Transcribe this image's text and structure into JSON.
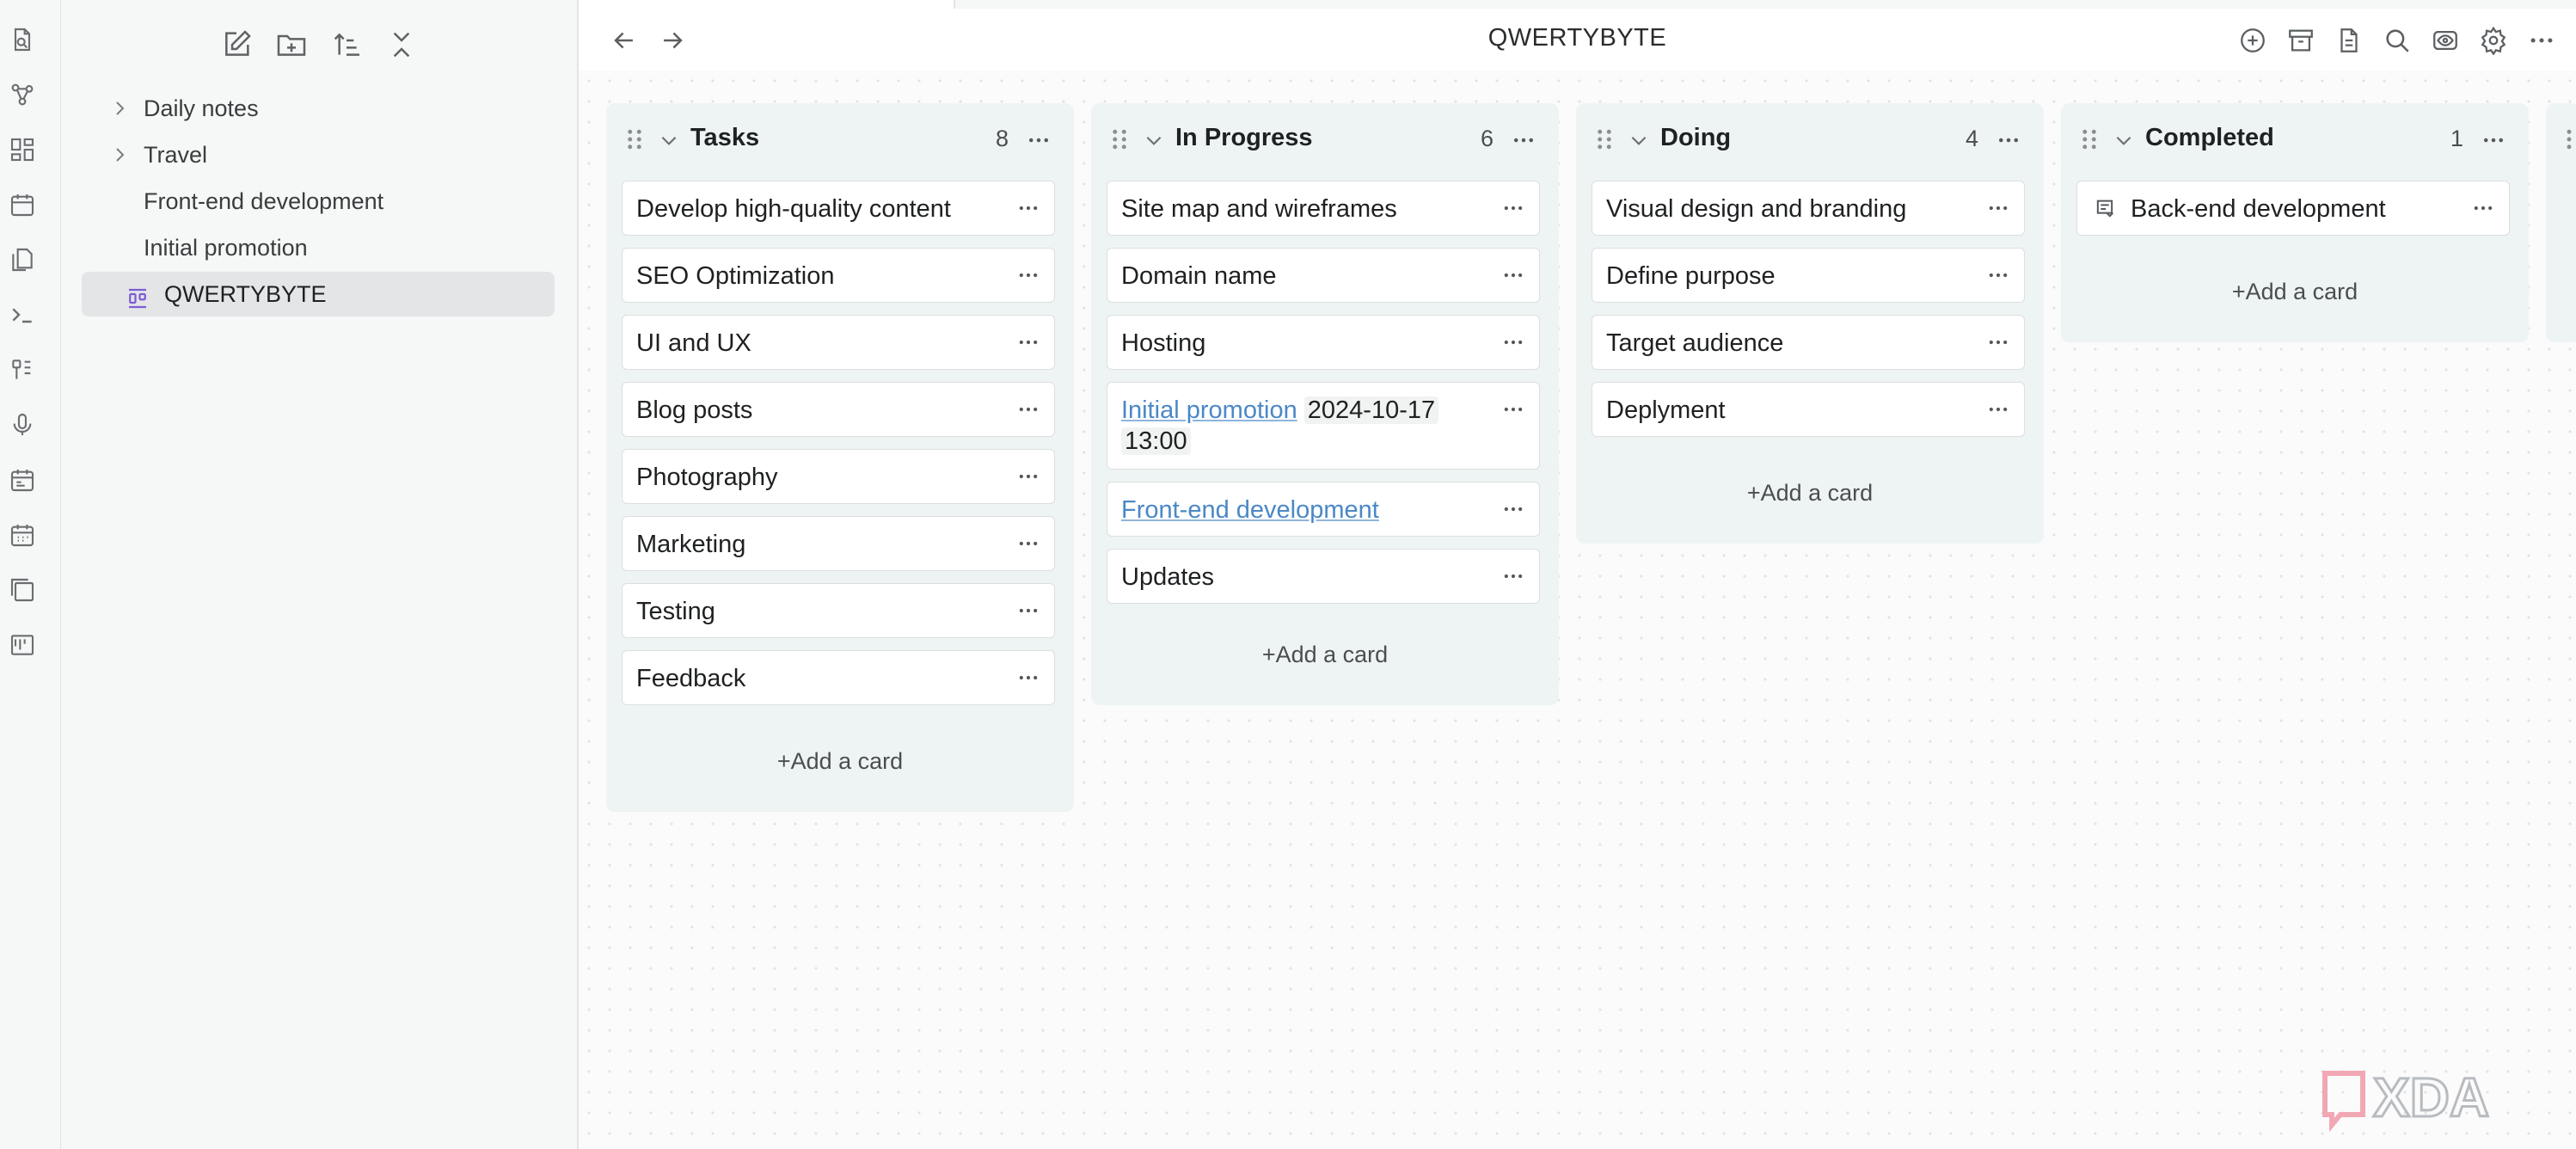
{
  "window": {
    "doc_title": "QWERTYBYTE"
  },
  "sidebar": {
    "tools": [
      "new-note-icon",
      "new-folder-icon",
      "sort-icon",
      "collapse-all-icon"
    ],
    "items": [
      {
        "label": "Daily notes",
        "type": "folder"
      },
      {
        "label": "Travel",
        "type": "folder"
      },
      {
        "label": "Front-end development",
        "type": "note"
      },
      {
        "label": "Initial promotion",
        "type": "note"
      },
      {
        "label": "QWERTYBYTE",
        "type": "kanban",
        "active": true
      }
    ]
  },
  "ribbon": {
    "icons": [
      "open-file-icon",
      "graph-view-icon",
      "canvas-icon",
      "daily-note-icon",
      "templates-icon",
      "command-palette-icon",
      "workspaces-icon",
      "audio-recorder-icon",
      "calendar-icon",
      "calendar-grid-icon",
      "slides-icon",
      "kanban-icon"
    ]
  },
  "toolbar": {
    "icons": [
      "add-icon",
      "archive-icon",
      "markdown-icon",
      "search-icon",
      "reading-view-icon",
      "settings-icon",
      "more-options-icon"
    ]
  },
  "board": {
    "add_label": "+Add a card",
    "lanes": [
      {
        "title": "Tasks",
        "count": "8",
        "cards": [
          {
            "text": "Develop high-quality content"
          },
          {
            "text": "SEO Optimization"
          },
          {
            "text": "UI and UX"
          },
          {
            "text": "Blog posts"
          },
          {
            "text": "Photography"
          },
          {
            "text": "Marketing"
          },
          {
            "text": "Testing"
          },
          {
            "text": "Feedback"
          }
        ]
      },
      {
        "title": "In Progress",
        "count": "6",
        "cards": [
          {
            "text": "Site map and wireframes"
          },
          {
            "text": "Domain name"
          },
          {
            "text": "Hosting"
          },
          {
            "link": "Initial promotion",
            "date": "2024-10-17",
            "time": "13:00"
          },
          {
            "link": "Front-end development"
          },
          {
            "text": "Updates"
          }
        ]
      },
      {
        "title": "Doing",
        "count": "4",
        "cards": [
          {
            "text": "Visual design and branding"
          },
          {
            "text": "Define purpose"
          },
          {
            "text": "Target audience"
          },
          {
            "text": "Deplyment"
          }
        ]
      },
      {
        "title": "Completed",
        "count": "1",
        "cards": [
          {
            "text": "Back-end development",
            "icon": "archived-card-icon"
          }
        ]
      }
    ]
  },
  "watermark": {
    "text": "XDA"
  },
  "colors": {
    "accent": "#7c5cd6",
    "link": "#4a88c7",
    "lane_bg": "#eef4f4"
  }
}
